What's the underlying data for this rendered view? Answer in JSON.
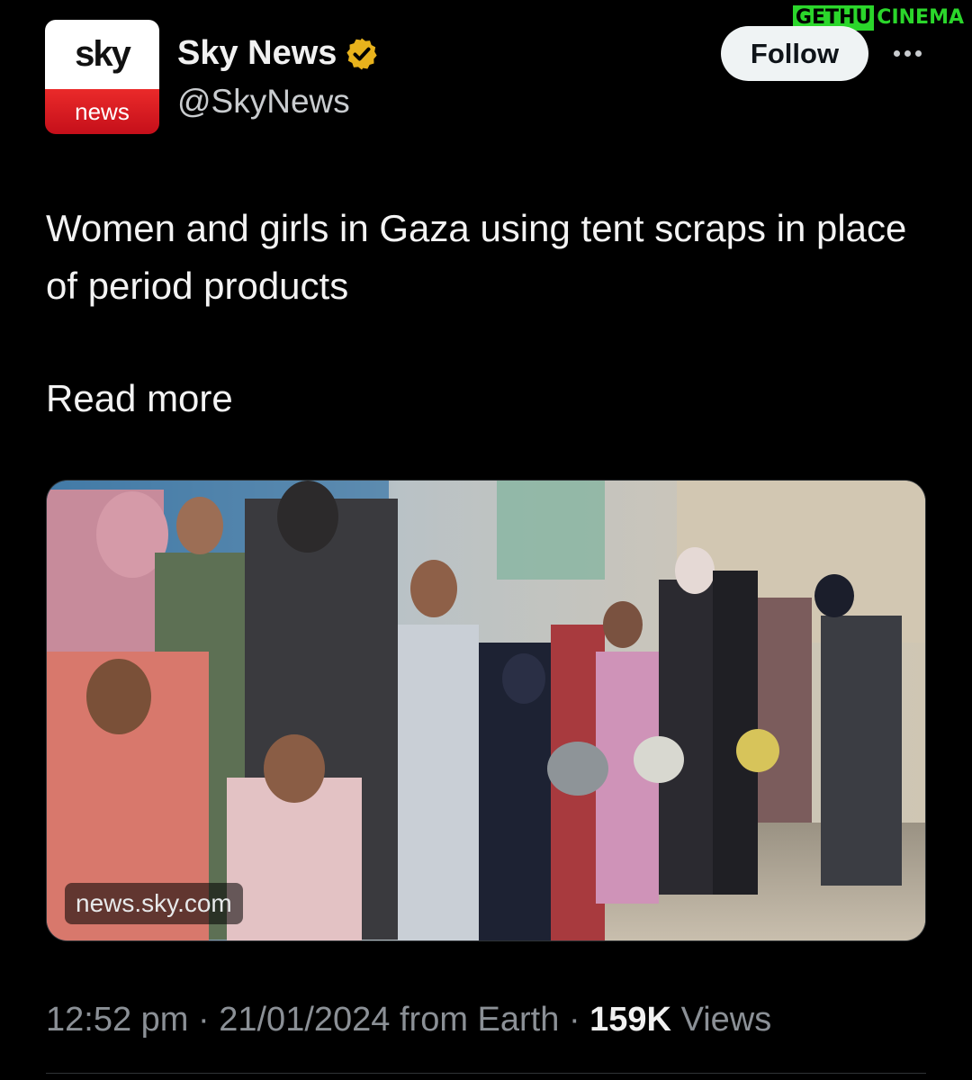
{
  "watermark": {
    "part_a": "GETHU",
    "part_b": "CINEMA"
  },
  "author": {
    "avatar_top": "sky",
    "avatar_bottom": "news",
    "display_name": "Sky News",
    "handle": "@SkyNews",
    "verified_icon": "verified-badge-icon",
    "verified_color": "#e8b21c"
  },
  "actions": {
    "follow_label": "Follow",
    "more_icon": "more-icon"
  },
  "tweet": {
    "text": "Women and girls in Gaza using tent scraps in place of period products",
    "read_more": "Read more"
  },
  "media": {
    "domain": "news.sky.com"
  },
  "meta": {
    "time": "12:52 pm",
    "date": "21/01/2024",
    "location": "from Earth",
    "views_count": "159K",
    "views_label": "Views",
    "separator": "·"
  },
  "colors": {
    "background": "#000000",
    "text": "#f3f3f3",
    "muted": "#8b9096",
    "sky_red": "#d4151f"
  }
}
